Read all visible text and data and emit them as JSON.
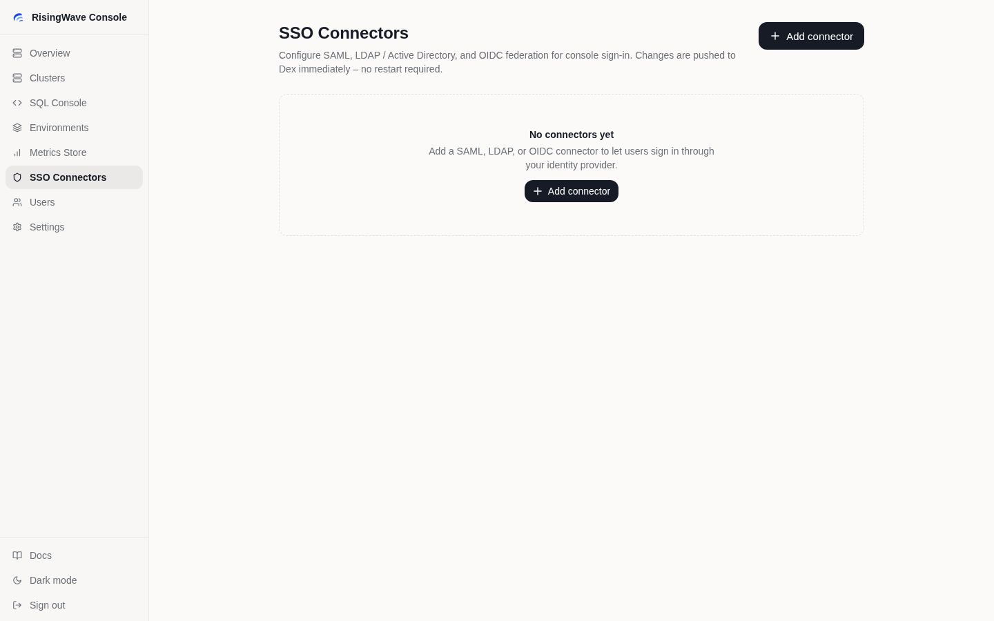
{
  "sidebar": {
    "brand": "RisingWave Console",
    "nav": [
      {
        "label": "Overview",
        "selected": false
      },
      {
        "label": "Clusters",
        "selected": false
      },
      {
        "label": "SQL Console",
        "selected": false
      },
      {
        "label": "Environments",
        "selected": false
      },
      {
        "label": "Metrics Store",
        "selected": false
      },
      {
        "label": "SSO Connectors",
        "selected": true
      },
      {
        "label": "Users",
        "selected": false
      },
      {
        "label": "Settings",
        "selected": false
      }
    ],
    "footer": [
      {
        "label": "Docs"
      },
      {
        "label": "Dark mode"
      },
      {
        "label": "Sign out"
      }
    ]
  },
  "page": {
    "title": "SSO Connectors",
    "description": "Configure SAML, LDAP / Active Directory, and OIDC federation for console sign-in. Changes are pushed to Dex immediately – no restart required.",
    "action": "Add connector"
  },
  "empty_state": {
    "title": "No connectors yet",
    "text": "Add a SAML, LDAP, or OIDC connector to let users sign in through your identity provider.",
    "action": "Add connector"
  }
}
